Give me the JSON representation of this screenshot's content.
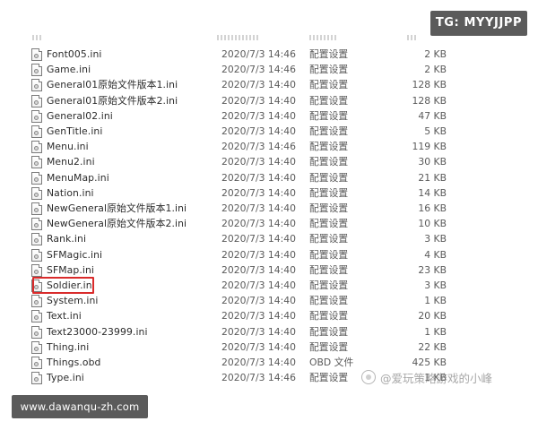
{
  "overlays": {
    "tg_badge": "TG: MYYJJPP",
    "url_badge": "www.dawanqu-zh.com",
    "toutiao_watermark": "@爱玩策略游戏的小峰"
  },
  "highlight": {
    "color": "#d92b2b",
    "file_name": "Soldier.ini"
  },
  "files": [
    {
      "name": "Font005.ini",
      "date": "2020/7/3 14:46",
      "type": "配置设置",
      "size": "2 KB"
    },
    {
      "name": "Game.ini",
      "date": "2020/7/3 14:46",
      "type": "配置设置",
      "size": "2 KB"
    },
    {
      "name": "General01原始文件版本1.ini",
      "date": "2020/7/3 14:40",
      "type": "配置设置",
      "size": "128 KB"
    },
    {
      "name": "General01原始文件版本2.ini",
      "date": "2020/7/3 14:40",
      "type": "配置设置",
      "size": "128 KB"
    },
    {
      "name": "General02.ini",
      "date": "2020/7/3 14:40",
      "type": "配置设置",
      "size": "47 KB"
    },
    {
      "name": "GenTitle.ini",
      "date": "2020/7/3 14:40",
      "type": "配置设置",
      "size": "5 KB"
    },
    {
      "name": "Menu.ini",
      "date": "2020/7/3 14:46",
      "type": "配置设置",
      "size": "119 KB"
    },
    {
      "name": "Menu2.ini",
      "date": "2020/7/3 14:40",
      "type": "配置设置",
      "size": "30 KB"
    },
    {
      "name": "MenuMap.ini",
      "date": "2020/7/3 14:40",
      "type": "配置设置",
      "size": "21 KB"
    },
    {
      "name": "Nation.ini",
      "date": "2020/7/3 14:40",
      "type": "配置设置",
      "size": "14 KB"
    },
    {
      "name": "NewGeneral原始文件版本1.ini",
      "date": "2020/7/3 14:40",
      "type": "配置设置",
      "size": "16 KB"
    },
    {
      "name": "NewGeneral原始文件版本2.ini",
      "date": "2020/7/3 14:40",
      "type": "配置设置",
      "size": "10 KB"
    },
    {
      "name": "Rank.ini",
      "date": "2020/7/3 14:40",
      "type": "配置设置",
      "size": "3 KB"
    },
    {
      "name": "SFMagic.ini",
      "date": "2020/7/3 14:40",
      "type": "配置设置",
      "size": "4 KB"
    },
    {
      "name": "SFMap.ini",
      "date": "2020/7/3 14:40",
      "type": "配置设置",
      "size": "23 KB"
    },
    {
      "name": "Soldier.ini",
      "date": "2020/7/3 14:40",
      "type": "配置设置",
      "size": "3 KB"
    },
    {
      "name": "System.ini",
      "date": "2020/7/3 14:40",
      "type": "配置设置",
      "size": "1 KB"
    },
    {
      "name": "Text.ini",
      "date": "2020/7/3 14:40",
      "type": "配置设置",
      "size": "20 KB"
    },
    {
      "name": "Text23000-23999.ini",
      "date": "2020/7/3 14:40",
      "type": "配置设置",
      "size": "1 KB"
    },
    {
      "name": "Thing.ini",
      "date": "2020/7/3 14:40",
      "type": "配置设置",
      "size": "22 KB"
    },
    {
      "name": "Things.obd",
      "date": "2020/7/3 14:40",
      "type": "OBD 文件",
      "size": "425 KB"
    },
    {
      "name": "Type.ini",
      "date": "2020/7/3 14:46",
      "type": "配置设置",
      "size": "1 KB"
    }
  ]
}
